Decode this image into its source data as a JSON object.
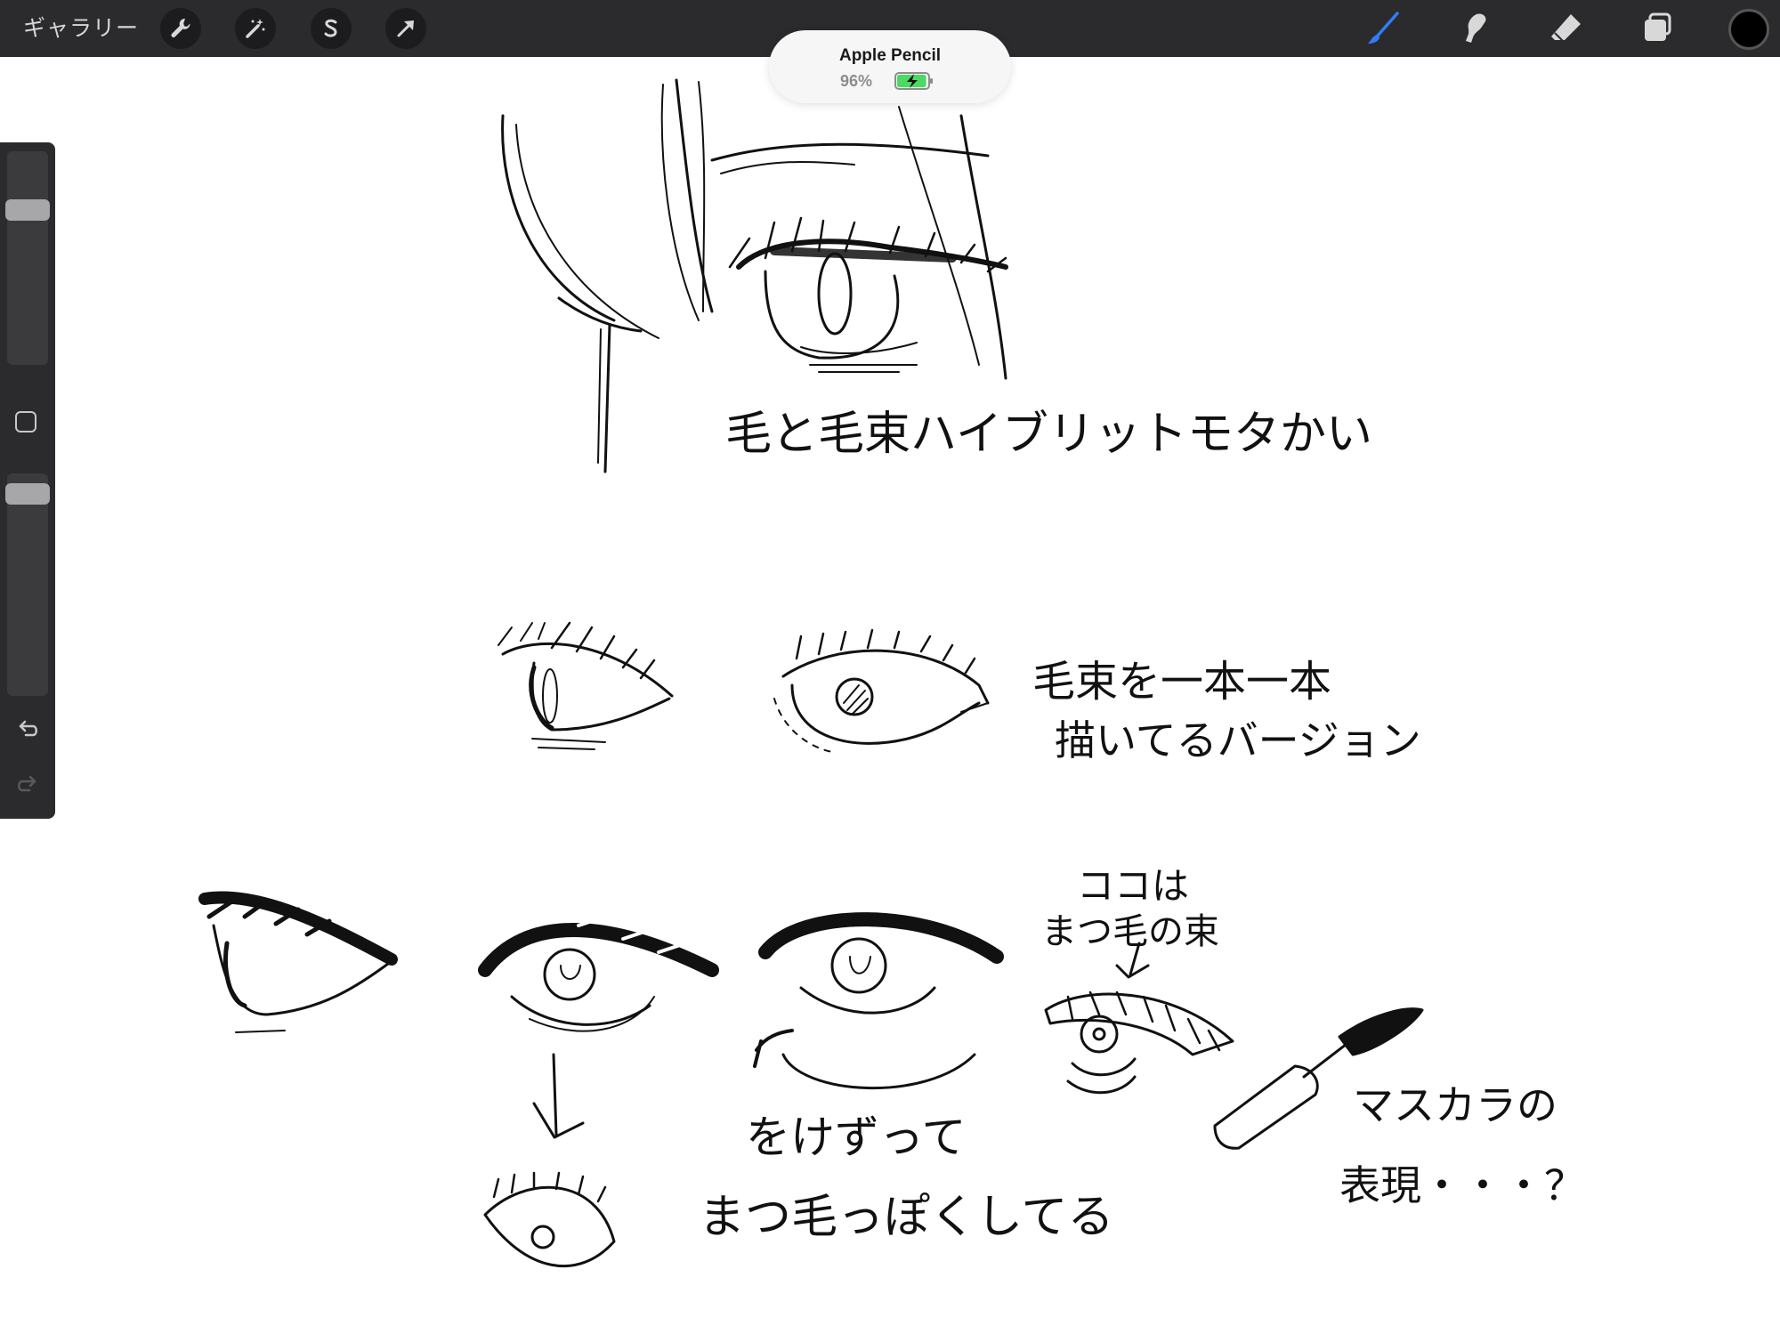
{
  "toolbar": {
    "gallery_label": "ギャラリー",
    "left_tools": [
      {
        "name": "actions",
        "icon": "wrench-icon"
      },
      {
        "name": "adjustments",
        "icon": "magic-wand-icon"
      },
      {
        "name": "selection",
        "icon": "selection-s-icon"
      },
      {
        "name": "transform",
        "icon": "arrow-cursor-icon"
      }
    ],
    "right_tools": [
      {
        "name": "brush",
        "icon": "brush-icon",
        "active": true
      },
      {
        "name": "smudge",
        "icon": "smudge-icon"
      },
      {
        "name": "eraser",
        "icon": "eraser-icon"
      },
      {
        "name": "layers",
        "icon": "layers-icon"
      }
    ],
    "accent_color": "#2f7cf6",
    "current_color": "#000000"
  },
  "pencil_status": {
    "device": "Apple Pencil",
    "battery_text": "96%",
    "battery_level": 0.96,
    "charging": true,
    "battery_color": "#4cd964"
  },
  "sidebar": {
    "brush_size_level": 0.75,
    "opacity_level": 0.95
  },
  "canvas": {
    "notes": {
      "note1": "毛と毛束ハイブリットモタかい",
      "note2_line1": "毛束を一本一本",
      "note2_line2": "描いてるバージョン",
      "note3_line1": "ココは",
      "note3_line2": "まつ毛の束",
      "note4": "をけずって",
      "note5": "まつ毛っぽくしてる",
      "note6_line1": "マスカラの",
      "note6_line2": "表現・・・？"
    }
  }
}
